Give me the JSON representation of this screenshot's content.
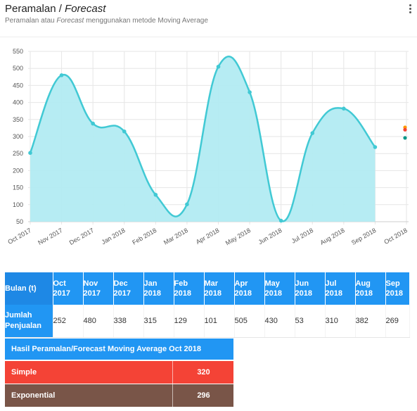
{
  "header": {
    "title_main": "Peramalan / ",
    "title_italic": "Forecast",
    "subtitle_pre": "Peramalan atau ",
    "subtitle_italic": "Forecast",
    "subtitle_post": " menggunakan metode Moving Average",
    "menu_icon": "more-vertical-icon"
  },
  "colors": {
    "line": "#41c9d4",
    "area": "#b2ebf2",
    "simple": "#f44336",
    "weighted": "#ff9800",
    "exponential": "#009688",
    "table_header": "#2196f3",
    "exponential_row": "#795548"
  },
  "chart_data": {
    "type": "area",
    "x": [
      "Oct 2017",
      "Nov 2017",
      "Dec 2017",
      "Jan 2018",
      "Feb 2018",
      "Mar 2018",
      "Apr 2018",
      "May 2018",
      "Jun 2018",
      "Jul 2018",
      "Aug 2018",
      "Sep 2018",
      "Oct 2018"
    ],
    "series": [
      {
        "values": [
          252,
          480,
          338,
          315,
          129,
          101,
          505,
          430,
          53,
          310,
          382,
          269
        ]
      }
    ],
    "forecast_points": [
      {
        "x": "Oct 2018",
        "value": 327,
        "color": "#ff9800"
      },
      {
        "x": "Oct 2018",
        "value": 320,
        "color": "#f44336"
      },
      {
        "x": "Oct 2018",
        "value": 296,
        "color": "#009688"
      }
    ],
    "yticks": [
      50,
      100,
      150,
      200,
      250,
      300,
      350,
      400,
      450,
      500,
      550
    ],
    "ylim": [
      50,
      550
    ],
    "grid": true,
    "title": "",
    "xlabel": "",
    "ylabel": ""
  },
  "table": {
    "row_header_label": "Bulan (t)",
    "months": [
      [
        "Oct",
        "2017"
      ],
      [
        "Nov",
        "2017"
      ],
      [
        "Dec",
        "2017"
      ],
      [
        "Jan",
        "2018"
      ],
      [
        "Feb",
        "2018"
      ],
      [
        "Mar",
        "2018"
      ],
      [
        "Apr",
        "2018"
      ],
      [
        "May",
        "2018"
      ],
      [
        "Jun",
        "2018"
      ],
      [
        "Jul",
        "2018"
      ],
      [
        "Aug",
        "2018"
      ],
      [
        "Sep",
        "2018"
      ]
    ],
    "value_label_1": "Jumlah",
    "value_label_2": "Penjualan",
    "values": [
      "252",
      "480",
      "338",
      "315",
      "129",
      "101",
      "505",
      "430",
      "53",
      "310",
      "382",
      "269"
    ]
  },
  "forecast": {
    "title": "Hasil Peramalan/Forecast Moving Average Oct 2018",
    "simple_label": "Simple",
    "simple_value": "320",
    "exponential_label": "Exponential",
    "exponential_value": "296"
  }
}
